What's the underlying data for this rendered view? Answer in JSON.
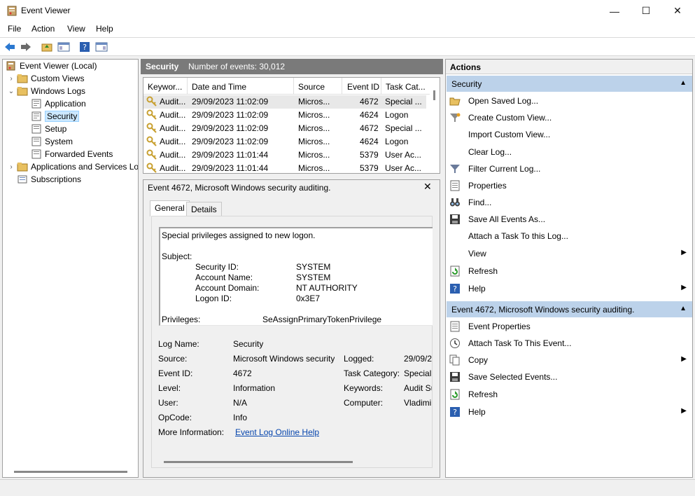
{
  "window": {
    "title": "Event Viewer",
    "minimize": "—",
    "maximize": "☐",
    "close": "✕"
  },
  "menu": [
    "File",
    "Action",
    "View",
    "Help"
  ],
  "tree": {
    "root": "Event Viewer (Local)",
    "custom_views": "Custom Views",
    "windows_logs": "Windows Logs",
    "application": "Application",
    "security": "Security",
    "setup": "Setup",
    "system": "System",
    "forwarded": "Forwarded Events",
    "apps_services": "Applications and Services Lo",
    "subscriptions": "Subscriptions"
  },
  "log_header": {
    "name": "Security",
    "count": "Number of events: 30,012"
  },
  "grid": {
    "columns": [
      "Keywor...",
      "Date and Time",
      "Source",
      "Event ID",
      "Task Cat..."
    ],
    "rows": [
      [
        "Audit...",
        "29/09/2023 11:02:09",
        "Micros...",
        "4672",
        "Special ..."
      ],
      [
        "Audit...",
        "29/09/2023 11:02:09",
        "Micros...",
        "4624",
        "Logon"
      ],
      [
        "Audit...",
        "29/09/2023 11:02:09",
        "Micros...",
        "4672",
        "Special ..."
      ],
      [
        "Audit...",
        "29/09/2023 11:02:09",
        "Micros...",
        "4624",
        "Logon"
      ],
      [
        "Audit...",
        "29/09/2023 11:01:44",
        "Micros...",
        "5379",
        "User Ac..."
      ],
      [
        "Audit...",
        "29/09/2023 11:01:44",
        "Micros...",
        "5379",
        "User Ac..."
      ]
    ]
  },
  "detail": {
    "title": "Event 4672, Microsoft Windows security auditing.",
    "close": "✕",
    "tabs": [
      "General",
      "Details"
    ],
    "description": {
      "line1": "Special privileges assigned to new logon.",
      "subject": "Subject:",
      "security_id_label": "Security ID:",
      "security_id": "SYSTEM",
      "account_name_label": "Account Name:",
      "account_name": "SYSTEM",
      "account_domain_label": "Account Domain:",
      "account_domain": "NT AUTHORITY",
      "logon_id_label": "Logon ID:",
      "logon_id": "0x3E7",
      "privileges_label": "Privileges:",
      "privileges": "SeAssignPrimaryTokenPrivilege"
    },
    "props": {
      "log_name_label": "Log Name:",
      "log_name": "Security",
      "source_label": "Source:",
      "source": "Microsoft Windows security",
      "logged_label": "Logged:",
      "logged": "29/09/2",
      "event_id_label": "Event ID:",
      "event_id": "4672",
      "task_category_label": "Task Category:",
      "task_category": "Special",
      "level_label": "Level:",
      "level": "Information",
      "keywords_label": "Keywords:",
      "keywords": "Audit Su",
      "user_label": "User:",
      "user": "N/A",
      "computer_label": "Computer:",
      "computer": "Vladimi",
      "opcode_label": "OpCode:",
      "opcode": "Info",
      "more_info_label": "More Information:",
      "more_info_link": "Event Log Online Help"
    }
  },
  "actions": {
    "header": "Actions",
    "section1": "Security",
    "section1_items": [
      "Open Saved Log...",
      "Create Custom View...",
      "Import Custom View...",
      "Clear Log...",
      "Filter Current Log...",
      "Properties",
      "Find...",
      "Save All Events As...",
      "Attach a Task To this Log...",
      "View",
      "Refresh",
      "Help"
    ],
    "section2": "Event 4672, Microsoft Windows security auditing.",
    "section2_items": [
      "Event Properties",
      "Attach Task To This Event...",
      "Copy",
      "Save Selected Events...",
      "Refresh",
      "Help"
    ]
  },
  "colors": {
    "section_bg": "#bcd2ea",
    "header_bg": "#7a7a7a",
    "selection": "#cce8ff",
    "link": "#0645ad"
  }
}
